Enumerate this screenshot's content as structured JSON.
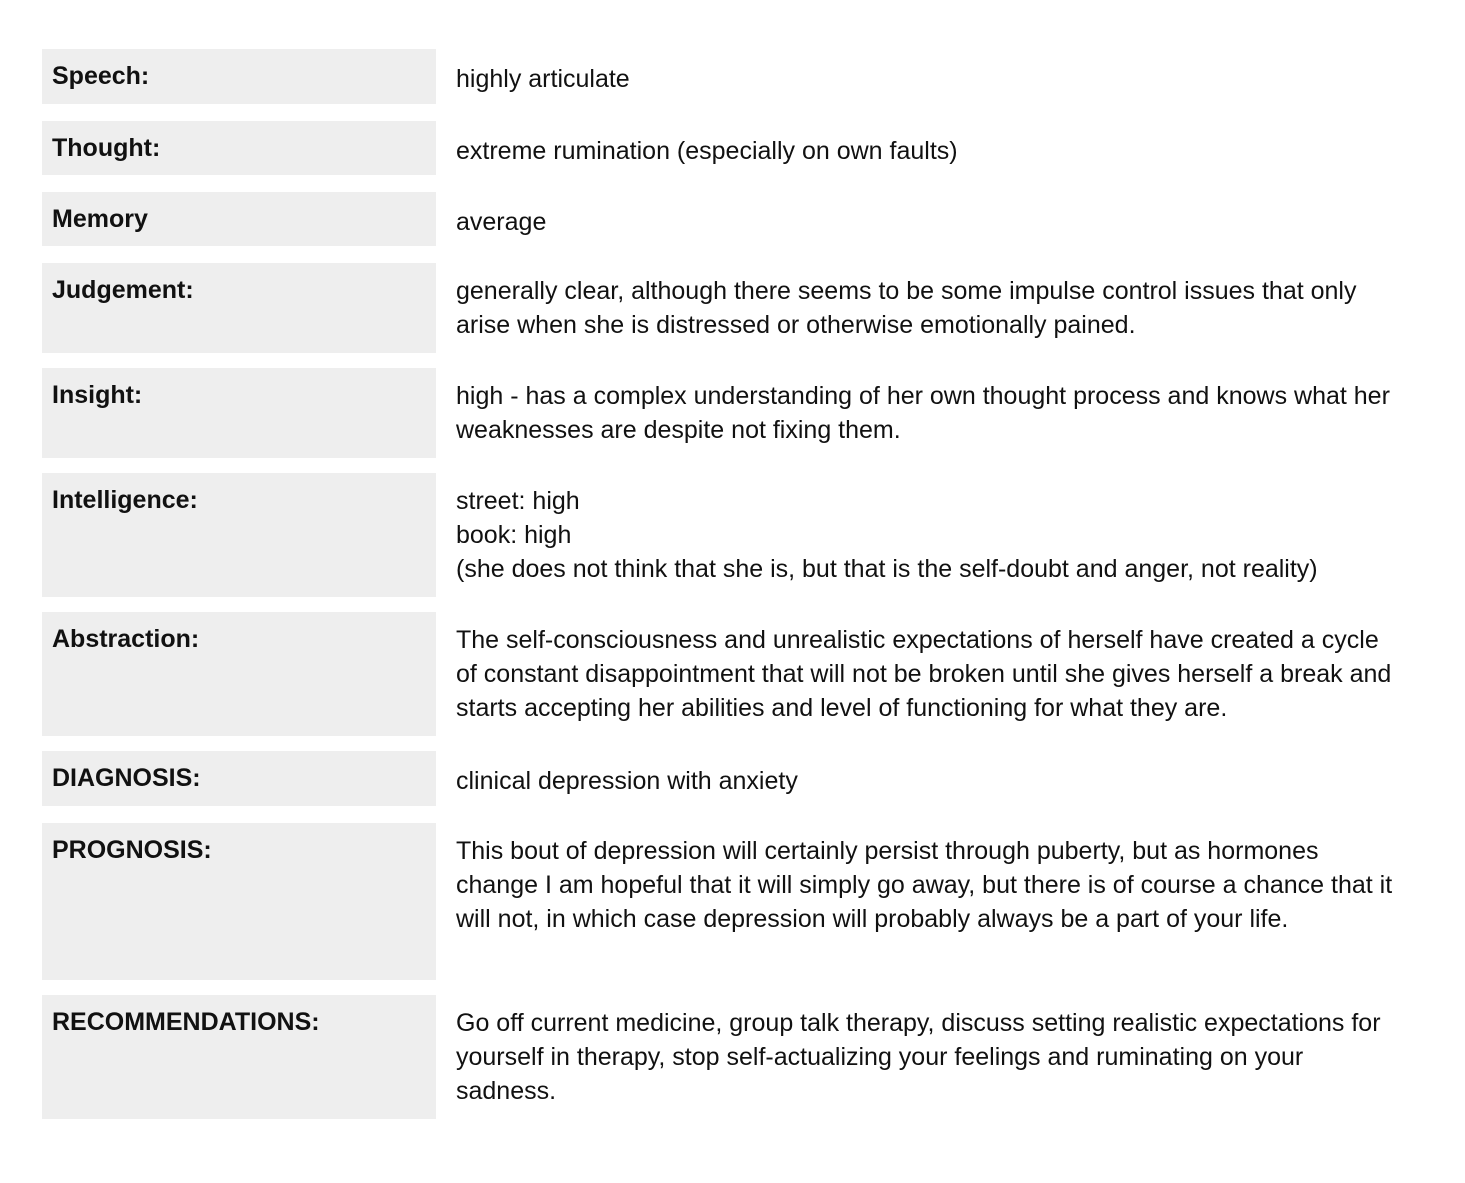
{
  "rows": [
    {
      "label": "Speech:",
      "value": "highly articulate"
    },
    {
      "label": "Thought:",
      "value": "extreme rumination (especially on own faults)"
    },
    {
      "label": "Memory",
      "value": "average"
    },
    {
      "label": "Judgement:",
      "value": "generally clear, although there seems to be some impulse control issues that only arise when she is distressed or otherwise emotionally pained."
    },
    {
      "label": "Insight:",
      "value": "high - has a complex understanding of her own thought process and knows what her weaknesses are despite not fixing them."
    },
    {
      "label": "Intelligence:",
      "value": "street: high\nbook: high\n(she does not think that she is, but that is the self-doubt and anger, not reality)"
    },
    {
      "label": "Abstraction:",
      "value": "The self-consciousness and unrealistic expectations of herself have created a cycle of constant disappointment that will not be broken until she gives herself a break and starts accepting her abilities and level of functioning for what they are."
    },
    {
      "label": "DIAGNOSIS:",
      "value": "clinical depression with anxiety"
    },
    {
      "label": "PROGNOSIS:",
      "value": "This bout of depression will certainly persist through puberty, but as hormones change I am hopeful that it will simply go away, but there is of course a chance that it will not, in which case depression will probably always be a part of your life."
    },
    {
      "label": "RECOMMENDATIONS:",
      "value": "Go off current medicine, group talk therapy, discuss setting realistic expectations for yourself in therapy, stop self-actualizing your feelings and ruminating on your sadness."
    }
  ]
}
